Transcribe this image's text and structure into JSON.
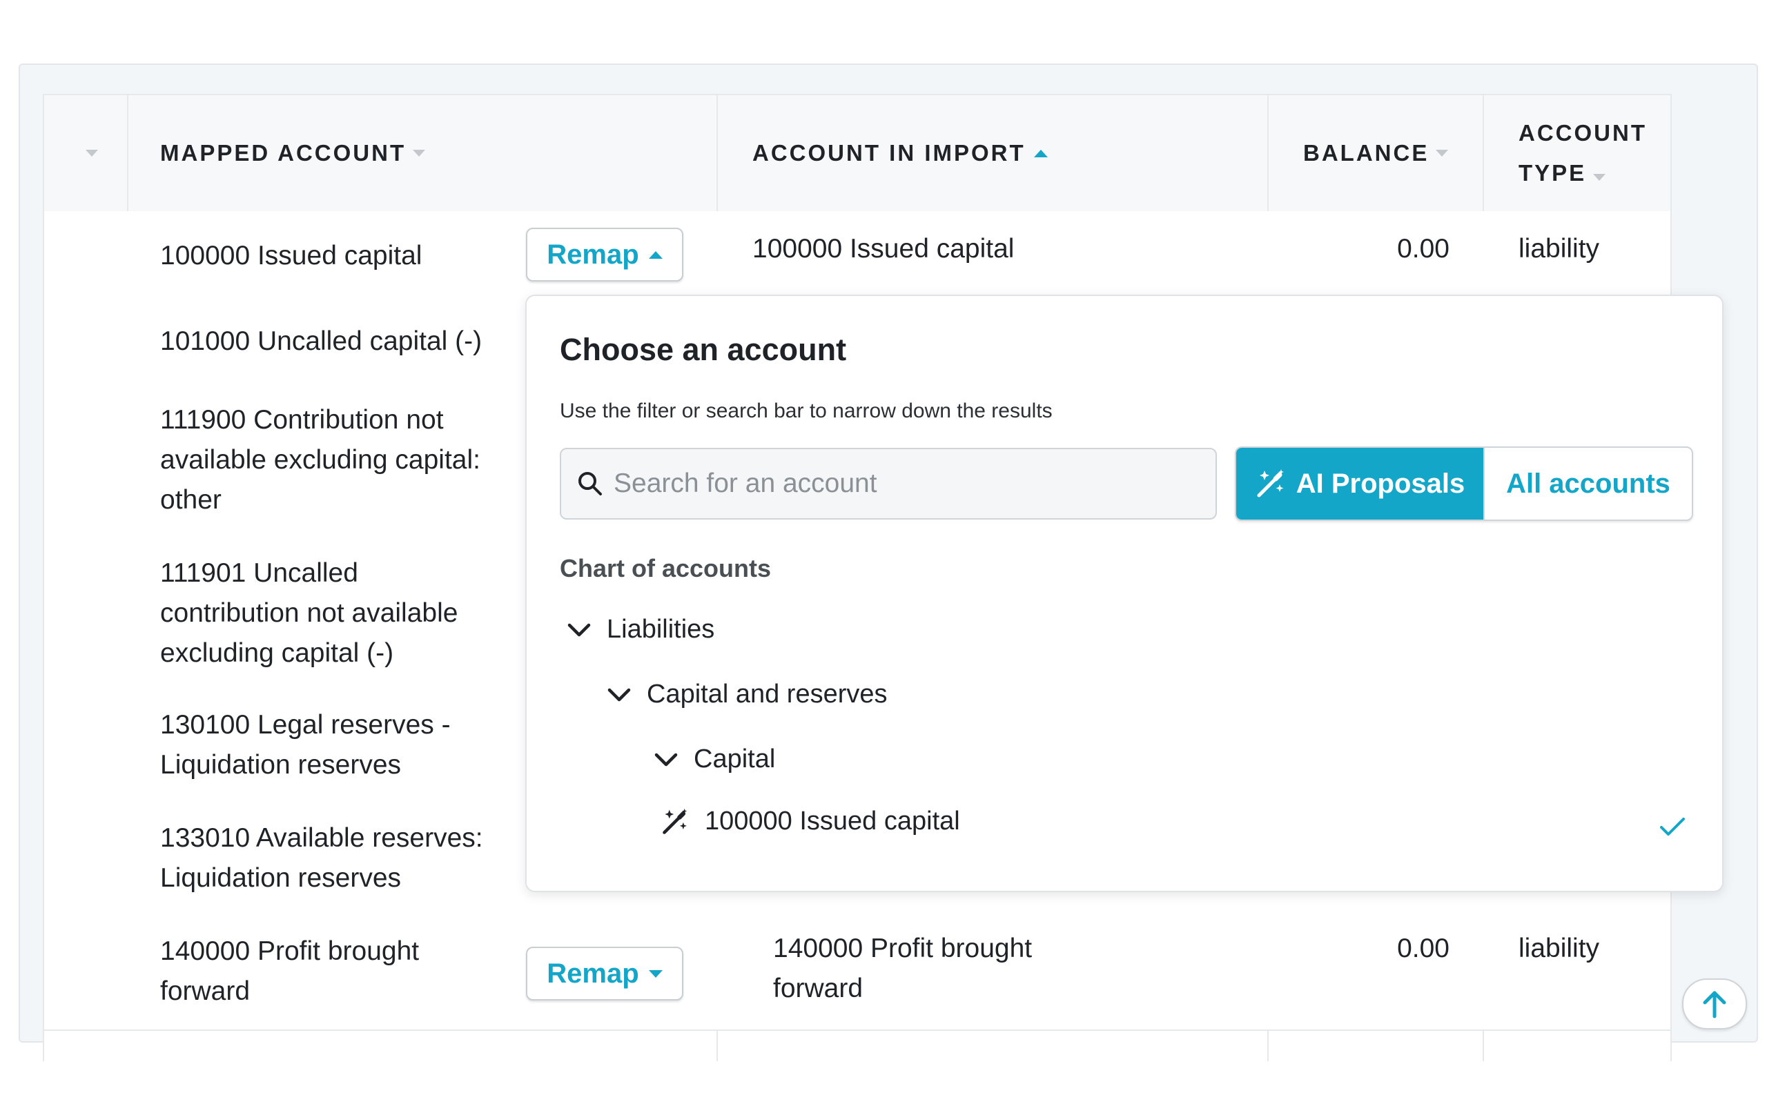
{
  "header": {
    "mapped_account": "MAPPED ACCOUNT",
    "account_in_import": "ACCOUNT IN IMPORT",
    "balance": "BALANCE",
    "account_type_line1": "ACCOUNT",
    "account_type_line2": "TYPE"
  },
  "rows": [
    {
      "mapped_line1": "100000 Issued capital",
      "import_line1": "100000 Issued capital",
      "balance": "0.00",
      "type": "liability",
      "remap": "Remap"
    },
    {
      "mapped_line1": "101000 Uncalled capital (-)"
    },
    {
      "mapped_line1": "111900 Contribution not",
      "mapped_line2": "available excluding capital:",
      "mapped_line3": "other"
    },
    {
      "mapped_line1": "111901 Uncalled",
      "mapped_line2": "contribution not available",
      "mapped_line3": "excluding capital (-)"
    },
    {
      "mapped_line1": "130100 Legal reserves -",
      "mapped_line2": "Liquidation reserves"
    },
    {
      "mapped_line1": "133010 Available reserves:",
      "mapped_line2": "Liquidation reserves"
    },
    {
      "mapped_line1": "140000 Profit brought",
      "mapped_line2": "forward",
      "import_line1": "140000 Profit brought",
      "import_line2": "forward",
      "balance": "0.00",
      "type": "liability",
      "remap": "Remap"
    }
  ],
  "popup": {
    "title": "Choose an account",
    "subtitle": "Use the filter or search bar to narrow down the results",
    "search_placeholder": "Search for an account",
    "ai_proposals": "AI Proposals",
    "all_accounts": "All accounts",
    "chart_heading": "Chart of accounts",
    "tree": {
      "level1": "Liabilities",
      "level2": "Capital and reserves",
      "level3": "Capital",
      "leaf": "100000 Issued capital"
    }
  },
  "colors": {
    "accent": "#13a6c8",
    "text": "#1f2328",
    "border": "#e6e9ec",
    "header_bg": "#f7f8fa"
  }
}
